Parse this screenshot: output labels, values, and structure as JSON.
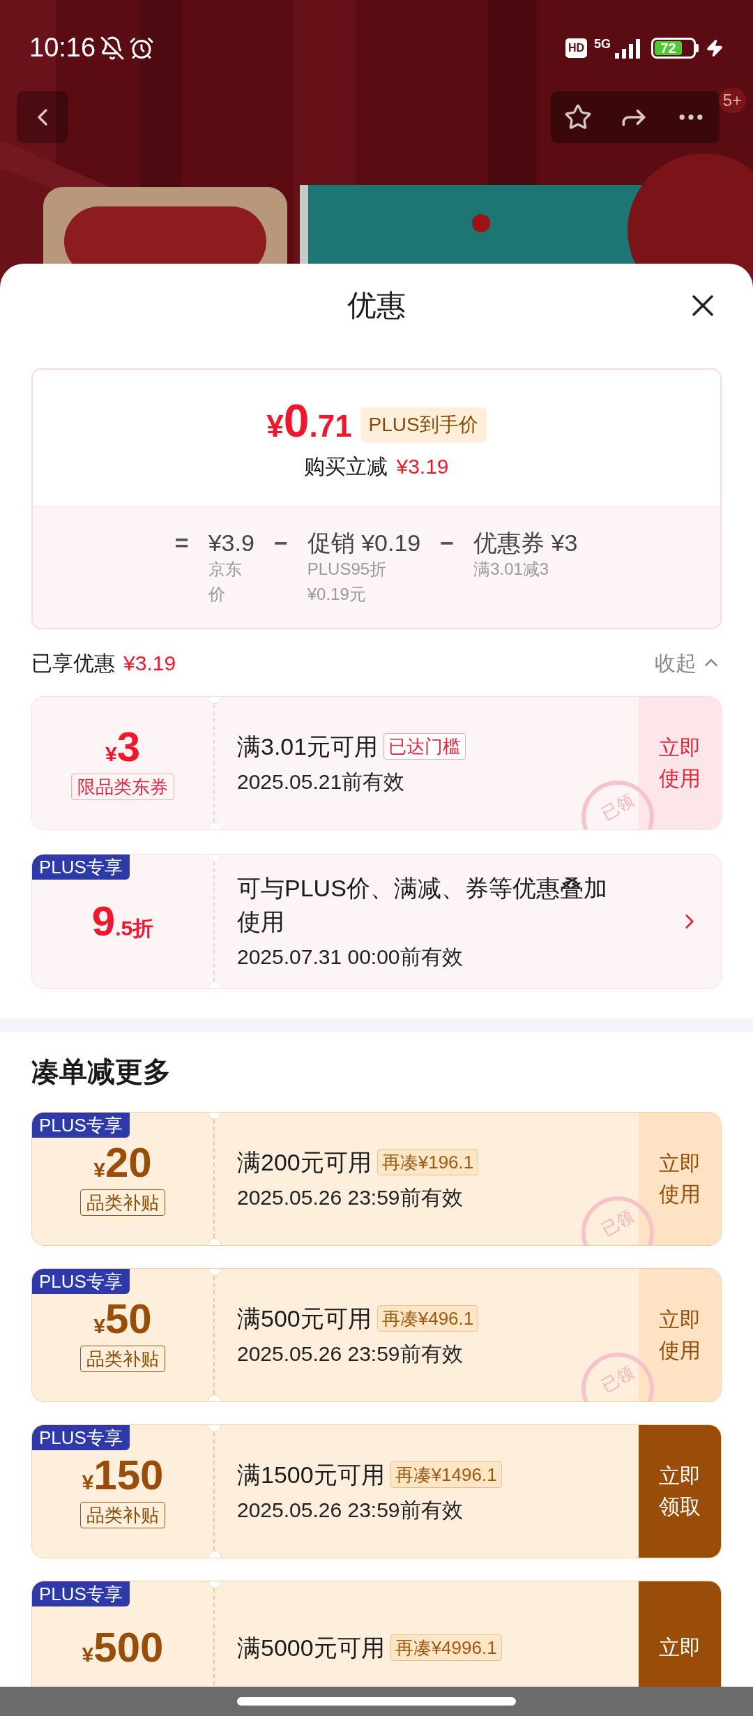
{
  "status_bar": {
    "time": "10:16",
    "hd": "HD",
    "network": "5G",
    "battery": "72",
    "charging": true
  },
  "top_bar": {
    "badge": "5+"
  },
  "sheet": {
    "title": "优惠"
  },
  "price_card": {
    "symbol": "¥",
    "integer": "0",
    "decimal": ".71",
    "tag": "PLUS到手价",
    "saving_label": "购买立减",
    "saving": "¥3.19",
    "breakdown": [
      {
        "op": "=",
        "value": "¥3.9",
        "note": "京东价"
      },
      {
        "op": "−",
        "value": "促销 ¥0.19",
        "note": "PLUS95折¥0.19元"
      },
      {
        "op": "−",
        "value": "优惠券 ¥3",
        "note": "满3.01减3"
      }
    ]
  },
  "enjoyed": {
    "label": "已享优惠",
    "amount": "¥3.19",
    "toggle": "收起",
    "expanded": true
  },
  "applied": [
    {
      "kind": "coupon",
      "symbol": "¥",
      "amount": "3",
      "tag": "限品类东券",
      "condition": "满3.01元可用",
      "badge": "已达门槛",
      "date": "2025.05.21前有效",
      "button": [
        "立即",
        "使用"
      ],
      "claimed": true,
      "stamp": "已领"
    },
    {
      "kind": "discount",
      "ribbon": "PLUS专享",
      "amount": "9",
      "unit": ".5折",
      "condition": "可与PLUS价、满减、券等优惠叠加使用",
      "date": "2025.07.31 00:00前有效"
    }
  ],
  "section_title": "凑单减更多",
  "more": [
    {
      "kind": "coupon",
      "ribbon": "PLUS专享",
      "symbol": "¥",
      "amount": "20",
      "tag": "品类补贴",
      "condition": "满200元可用",
      "badge": "再凑¥196.1",
      "date": "2025.05.26 23:59前有效",
      "button": [
        "立即",
        "使用"
      ],
      "claimed": true,
      "stamp": "已领"
    },
    {
      "kind": "coupon",
      "ribbon": "PLUS专享",
      "symbol": "¥",
      "amount": "50",
      "tag": "品类补贴",
      "condition": "满500元可用",
      "badge": "再凑¥496.1",
      "date": "2025.05.26 23:59前有效",
      "button": [
        "立即",
        "使用"
      ],
      "claimed": true,
      "stamp": "已领"
    },
    {
      "kind": "coupon",
      "ribbon": "PLUS专享",
      "symbol": "¥",
      "amount": "150",
      "tag": "品类补贴",
      "condition": "满1500元可用",
      "badge": "再凑¥1496.1",
      "date": "2025.05.26 23:59前有效",
      "button": [
        "立即",
        "领取"
      ],
      "claimed": false
    },
    {
      "kind": "coupon",
      "ribbon": "PLUS专享",
      "symbol": "¥",
      "amount": "500",
      "condition": "满5000元可用",
      "badge": "再凑¥4996.1",
      "button": [
        "立即"
      ],
      "claimed": false
    }
  ]
}
